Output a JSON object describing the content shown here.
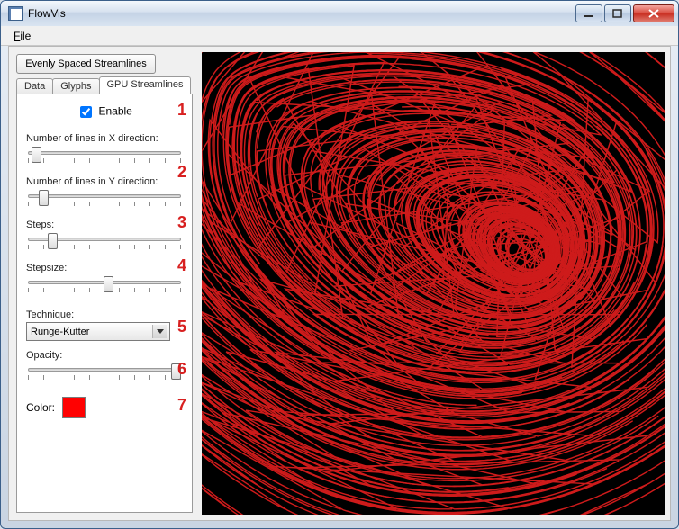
{
  "window": {
    "title": "FlowVis"
  },
  "menubar": {
    "file": "File"
  },
  "sidebar": {
    "top_button": "Evenly Spaced Streamlines",
    "tabs": [
      {
        "label": "Data"
      },
      {
        "label": "Glyphs"
      },
      {
        "label": "GPU Streamlines"
      }
    ],
    "active_tab_index": 2,
    "panel": {
      "enable_label": "Enable",
      "enable_checked": true,
      "lines_x_label": "Number of lines in X direction:",
      "lines_y_label": "Number of lines in Y direction:",
      "steps_label": "Steps:",
      "stepsize_label": "Stepsize:",
      "technique_label": "Technique:",
      "technique_value": "Runge-Kutter",
      "opacity_label": "Opacity:",
      "color_label": "Color:",
      "color_value": "#ff0101",
      "annotations": [
        "1",
        "2",
        "3",
        "4",
        "5",
        "6",
        "7"
      ]
    }
  },
  "visualization": {
    "stroke_color": "#ce1b1b",
    "background": "#000000"
  }
}
